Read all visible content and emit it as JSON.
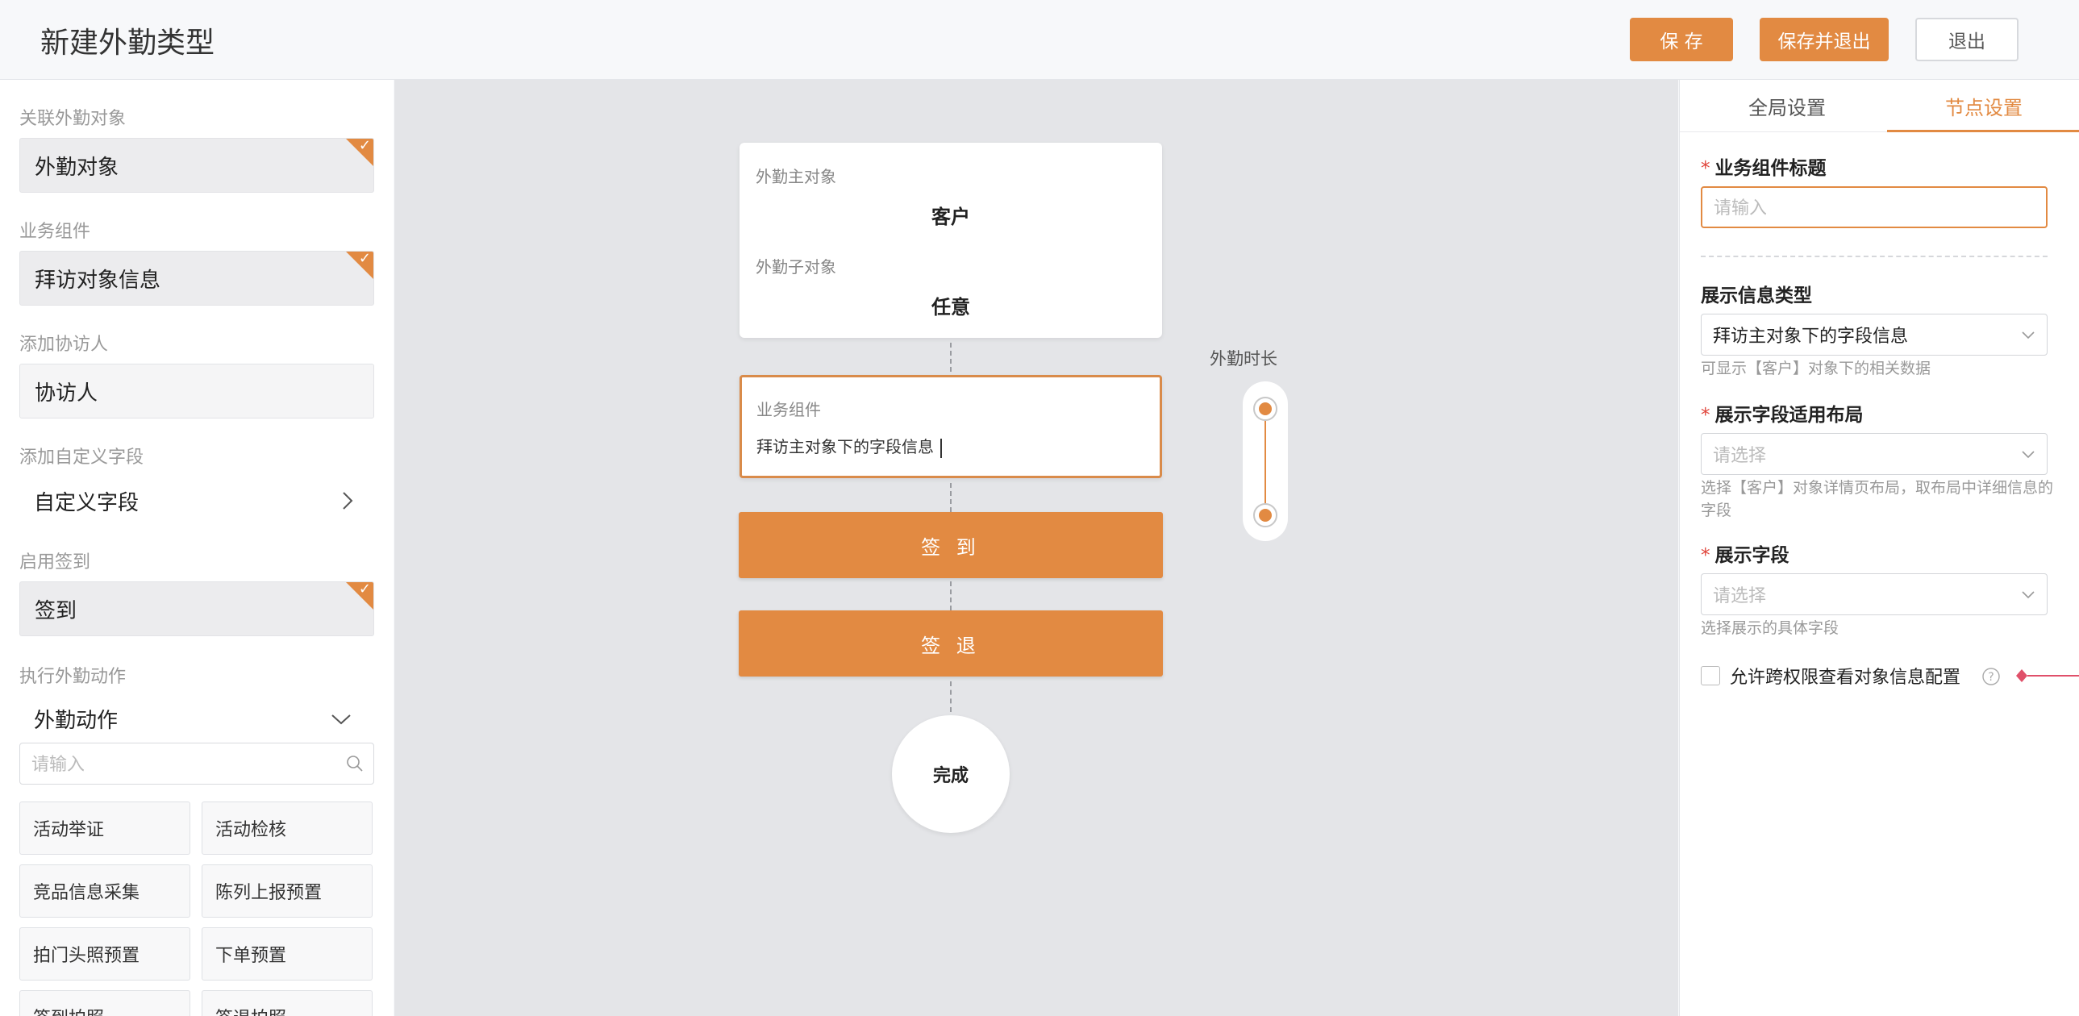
{
  "header": {
    "title": "新建外勤类型",
    "save_label": "保 存",
    "save_exit_label": "保存并退出",
    "exit_label": "退出"
  },
  "left": {
    "related_object_label": "关联外勤对象",
    "related_object_value": "外勤对象",
    "component_label": "业务组件",
    "component_value": "拜访对象信息",
    "collaborator_label": "添加协访人",
    "collaborator_value": "协访人",
    "custom_field_label": "添加自定义字段",
    "custom_field_value": "自定义字段",
    "checkin_label": "启用签到",
    "checkin_value": "签到",
    "action_label": "执行外勤动作",
    "action_value": "外勤动作",
    "search_placeholder": "请输入",
    "actions": [
      "活动举证",
      "活动检核",
      "竞品信息采集",
      "陈列上报预置",
      "拍门头照预置",
      "下单预置",
      "签到拍照",
      "签退拍照"
    ]
  },
  "canvas": {
    "main_object_label": "外勤主对象",
    "main_object_value": "客户",
    "sub_object_label": "外勤子对象",
    "sub_object_value": "任意",
    "component_label": "业务组件",
    "component_value": "拜访主对象下的字段信息",
    "checkin_label": "签 到",
    "checkout_label": "签 退",
    "finish_label": "完成",
    "duration_label": "外勤时长"
  },
  "right": {
    "tabs": [
      {
        "label": "全局设置",
        "active": false
      },
      {
        "label": "节点设置",
        "active": true
      }
    ],
    "title_label": "业务组件标题",
    "title_placeholder": "请输入",
    "info_type_label": "展示信息类型",
    "info_type_value": "拜访主对象下的字段信息",
    "info_type_hint": "可显示【客户】对象下的相关数据",
    "layout_label": "展示字段适用布局",
    "layout_placeholder": "请选择",
    "layout_hint": "选择【客户】对象详情页布局，取布局中详细信息的字段",
    "fields_label": "展示字段",
    "fields_placeholder": "请选择",
    "fields_hint": "选择展示的具体字段",
    "cross_auth_label": "允许跨权限查看对象信息配置",
    "cross_auth_checked": false
  },
  "colors": {
    "accent": "#e28a42",
    "required": "#e0443a",
    "annotation": "#e0506a"
  }
}
